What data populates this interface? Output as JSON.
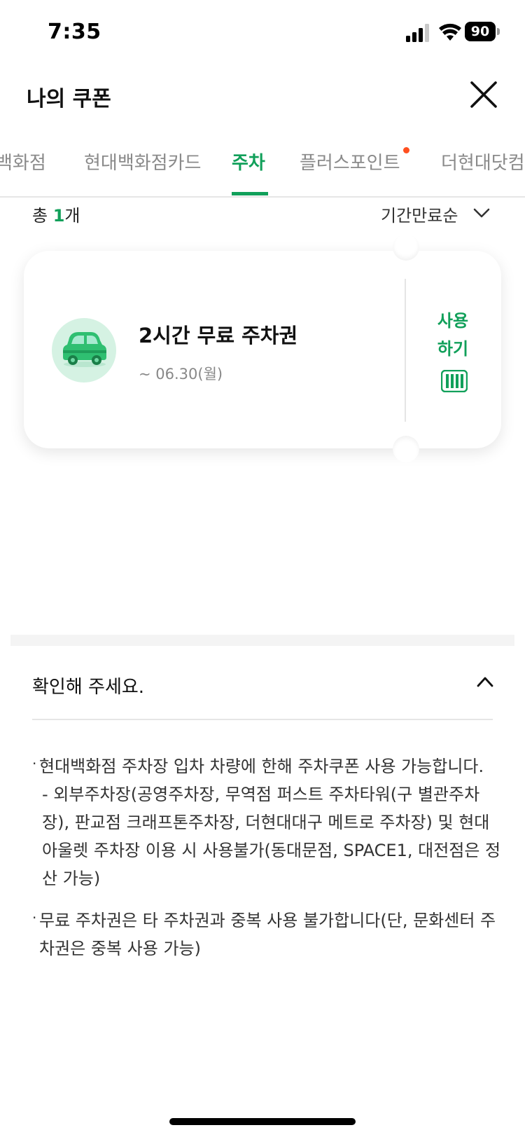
{
  "status_bar": {
    "time": "7:35",
    "battery": "90"
  },
  "header": {
    "title": "나의 쿠폰"
  },
  "tabs": [
    {
      "label": "백화점",
      "active": false
    },
    {
      "label": "현대백화점카드",
      "active": false
    },
    {
      "label": "주차",
      "active": true
    },
    {
      "label": "플러스포인트",
      "active": false,
      "has_new_dot": true
    },
    {
      "label": "더현대닷컴",
      "active": false
    }
  ],
  "summary": {
    "prefix": "총 ",
    "count": "1",
    "suffix": "개",
    "sort_label": "기간만료순"
  },
  "coupon": {
    "title": "2시간 무료 주차권",
    "expiry": "~ 06.30(월)",
    "use_line1": "사용",
    "use_line2": "하기"
  },
  "notice": {
    "title": "확인해 주세요.",
    "items": [
      "현대백화점 주차장 입차 차량에 한해 주차쿠폰 사용 가능합니다.",
      "- 외부주차장(공영주차장, 무역점 퍼스트 주차타워(구 별관주차장), 판교점 크래프톤주차장, 더현대대구 메트로 주차장) 및 현대아울렛 주차장 이용 시 사용불가(동대문점, SPACE1, 대전점은 정산 가능)",
      "무료 주차권은 타 주차권과 중복 사용 불가합니다(단, 문화센터 주차권은 중복 사용 가능)"
    ]
  },
  "colors": {
    "accent": "#11a05a",
    "dot": "#ff4f1f"
  }
}
